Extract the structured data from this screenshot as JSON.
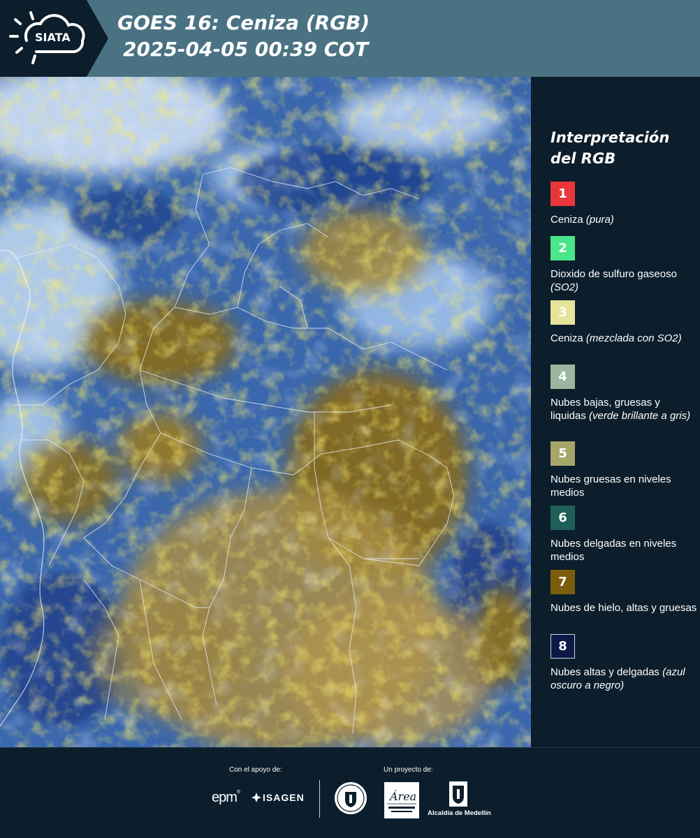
{
  "header": {
    "logo_text": "SIATA",
    "title_line1": "GOES 16: Ceniza (RGB)",
    "title_line2": "2025-04-05 00:39 COT"
  },
  "legend": {
    "title_line1": "Interpretación",
    "title_line2": "del RGB",
    "items": [
      {
        "number": "1",
        "color": "#e8363a",
        "text": "Ceniza",
        "italic": "(pura)"
      },
      {
        "number": "2",
        "color": "#4be58a",
        "text": "Dioxido de sulfuro gaseoso",
        "italic": "(SO2)"
      },
      {
        "number": "3",
        "color": "#e6e39a",
        "text": "Ceniza",
        "italic": "(mezclada con SO2)"
      },
      {
        "number": "4",
        "color": "#9bb59f",
        "text": "Nubes bajas, gruesas y liquidas",
        "italic": "(verde brillante a gris)"
      },
      {
        "number": "5",
        "color": "#a6a668",
        "text": "Nubes gruesas en niveles medios",
        "italic": ""
      },
      {
        "number": "6",
        "color": "#1f5f57",
        "text": "Nubes delgadas en niveles medios",
        "italic": ""
      },
      {
        "number": "7",
        "color": "#7a5e0c",
        "text": "Nubes de hielo, altas y gruesas",
        "italic": ""
      },
      {
        "number": "8",
        "color": "#0c1848",
        "text": "Nubes altas y delgadas",
        "italic": "(azul oscuro a negro)"
      }
    ]
  },
  "footer": {
    "support_label": "Con el apoyo de:",
    "project_label": "Un proyecto de:",
    "epm": "epm",
    "isagen": "ISAGEN",
    "alcaldia": "Alcaldía de Medellín"
  },
  "colors": {
    "header_bg": "#4a7282",
    "panel_bg": "#0c1e2b"
  }
}
